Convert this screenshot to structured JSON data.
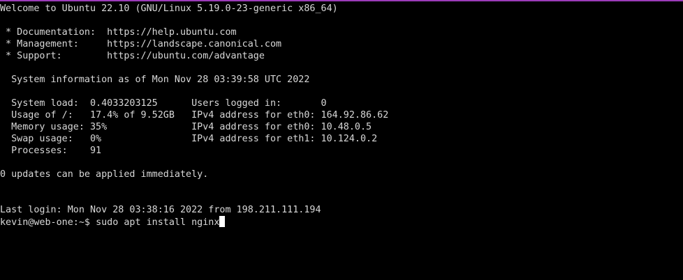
{
  "terminal": {
    "welcome": "Welcome to Ubuntu 22.10 (GNU/Linux 5.19.0-23-generic x86_64)",
    "doc_line": " * Documentation:  https://help.ubuntu.com",
    "mgmt_line": " * Management:     https://landscape.canonical.com",
    "support_line": " * Support:        https://ubuntu.com/advantage",
    "sysinfo_header": "  System information as of Mon Nov 28 03:39:58 UTC 2022",
    "stats": [
      "  System load:  0.4033203125      Users logged in:       0",
      "  Usage of /:   17.4% of 9.52GB   IPv4 address for eth0: 164.92.86.62",
      "  Memory usage: 35%               IPv4 address for eth0: 10.48.0.5",
      "  Swap usage:   0%                IPv4 address for eth1: 10.124.0.2",
      "  Processes:    91"
    ],
    "updates_line": "0 updates can be applied immediately.",
    "last_login": "Last login: Mon Nov 28 03:38:16 2022 from 198.211.111.194",
    "prompt": "kevin@web-one:~$ ",
    "command": "sudo apt install nginx"
  }
}
